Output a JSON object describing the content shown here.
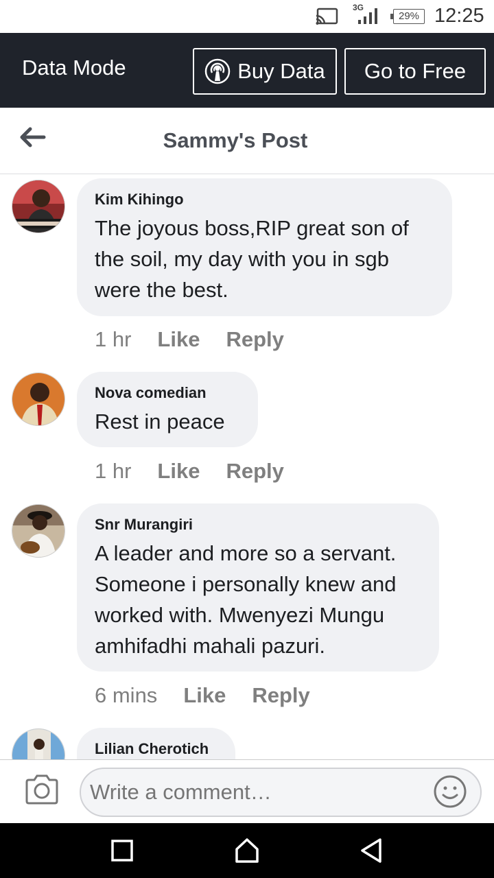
{
  "status_bar": {
    "network": "3G",
    "battery": "29%",
    "time": "12:25",
    "icons": [
      "cast-icon",
      "signal-icon",
      "battery-icon"
    ]
  },
  "data_bar": {
    "title": "Data Mode",
    "buy_label": "Buy Data",
    "free_label": "Go to Free"
  },
  "header": {
    "title": "Sammy's Post"
  },
  "comments": [
    {
      "author": "Kim Kihingo",
      "text": "The joyous boss,RIP great son of the soil, my day with you in sgb were the best.",
      "time": "1 hr",
      "like": "Like",
      "reply": "Reply"
    },
    {
      "author": "Nova comedian",
      "text": "Rest in peace",
      "time": "1 hr",
      "like": "Like",
      "reply": "Reply"
    },
    {
      "author": "Snr Murangiri",
      "text": "A leader and more so a servant. Someone i personally knew and worked with. Mwenyezi Mungu amhifadhi mahali pazuri.",
      "time": "6 mins",
      "like": "Like",
      "reply": "Reply"
    },
    {
      "author": "Lilian Cherotich"
    }
  ],
  "composer": {
    "placeholder": "Write a comment…"
  },
  "colors": {
    "top_bar": "#1f232b",
    "bubble": "#f0f1f4",
    "meta": "#7f7f7f",
    "title": "#4b4f56"
  }
}
